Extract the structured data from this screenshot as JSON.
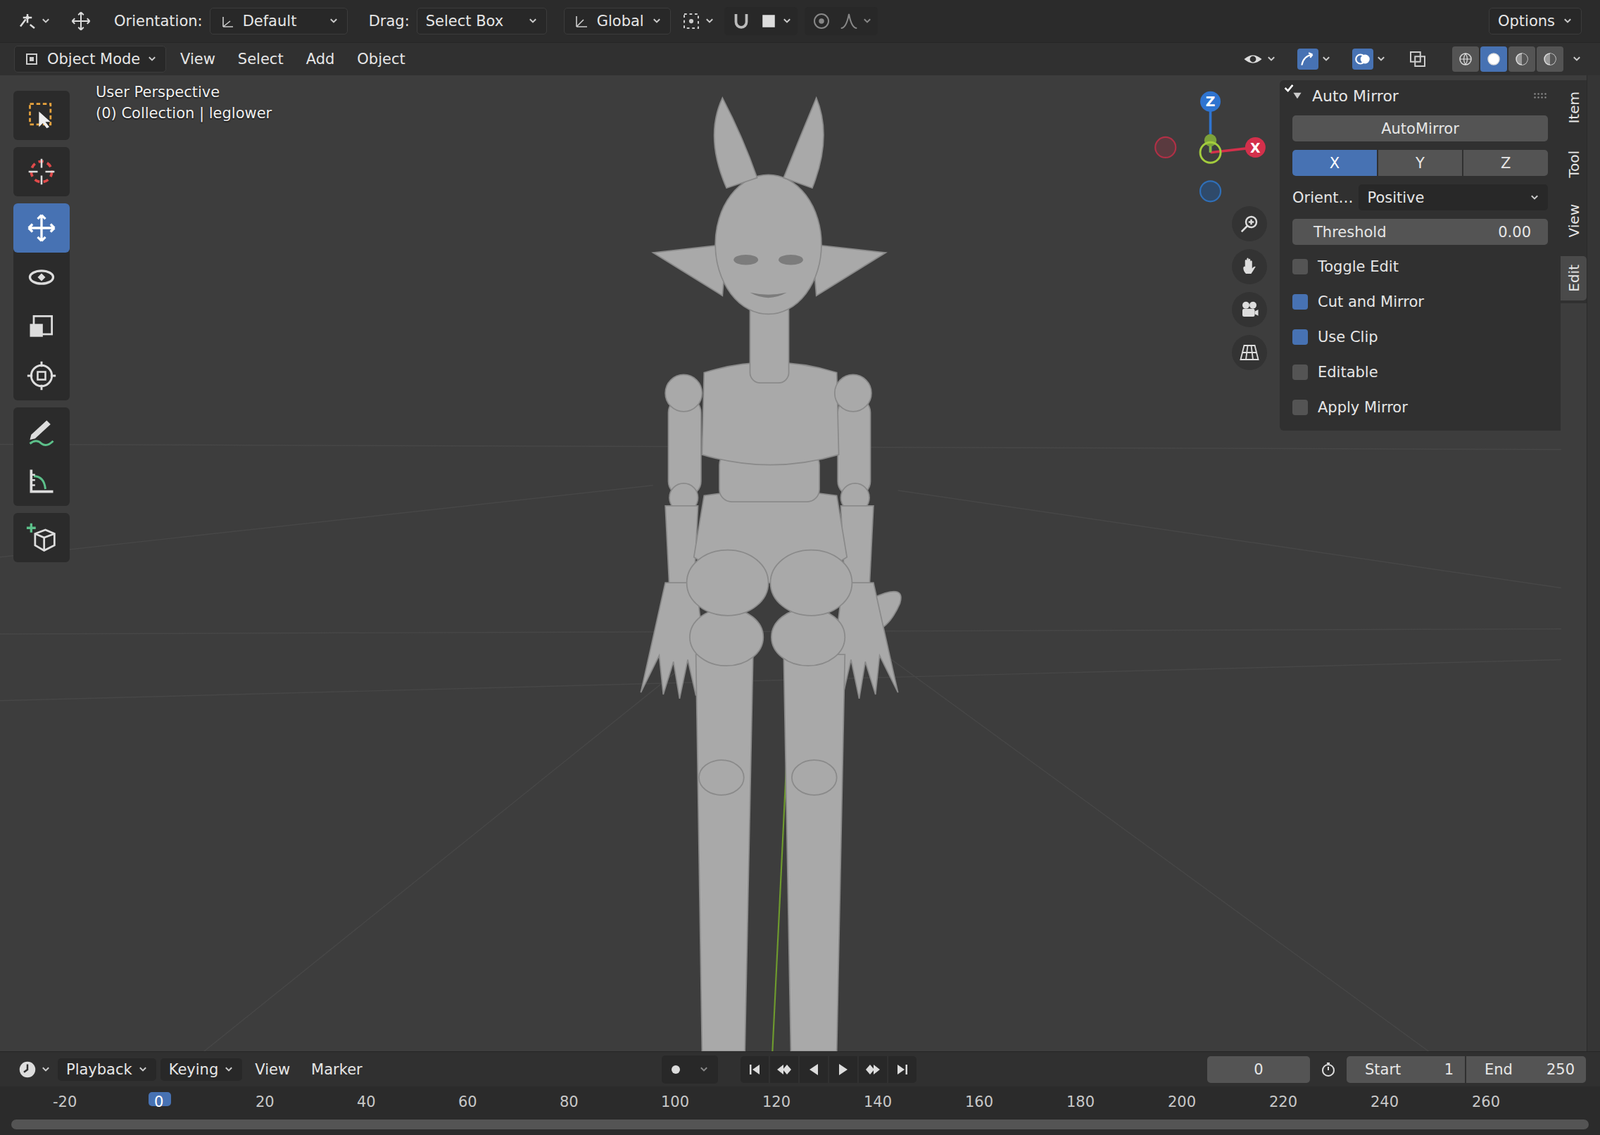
{
  "window": {
    "title": "Blender 3D Viewport"
  },
  "tool_settings": {
    "orientation_label": "Orientation:",
    "orientation": "Default",
    "drag_label": "Drag:",
    "drag": "Select Box",
    "transform_orientation": "Global",
    "options": "Options"
  },
  "header": {
    "mode": "Object Mode",
    "menus": [
      "View",
      "Select",
      "Add",
      "Object"
    ],
    "view_toggles": [
      {
        "kind": "visibility",
        "selected": false
      },
      {
        "kind": "gizmo",
        "selected": true
      },
      {
        "kind": "overlay",
        "selected": true
      },
      {
        "kind": "xray",
        "selected": false
      }
    ],
    "shading": [
      {
        "kind": "wireframe",
        "selected": false
      },
      {
        "kind": "solid",
        "selected": true
      },
      {
        "kind": "material",
        "selected": false
      },
      {
        "kind": "rendered",
        "selected": false
      }
    ]
  },
  "tool_groups": [
    [
      {
        "kind": "select-box",
        "selected": false
      }
    ],
    [
      {
        "kind": "cursor",
        "selected": false
      }
    ],
    [
      {
        "kind": "move",
        "selected": true
      },
      {
        "kind": "rotate",
        "selected": false
      },
      {
        "kind": "scale",
        "selected": false
      },
      {
        "kind": "transform",
        "selected": false
      }
    ],
    [
      {
        "kind": "annotate",
        "selected": false
      },
      {
        "kind": "measure",
        "selected": false
      }
    ],
    [
      {
        "kind": "add-cube",
        "selected": false
      }
    ]
  ],
  "viewport": {
    "view_name": "User Perspective",
    "collection": "(0) Collection | leglower"
  },
  "gizmo": {
    "axes": [
      {
        "label": "Z",
        "color": "#2f74d0"
      },
      {
        "label": "X",
        "color": "#d3304b"
      }
    ]
  },
  "sidebar": {
    "panel": "Auto Mirror",
    "expanded": true,
    "button": "AutoMirror",
    "axes": [
      {
        "label": "X",
        "selected": true
      },
      {
        "label": "Y",
        "selected": false
      },
      {
        "label": "Z",
        "selected": false
      }
    ],
    "orient_label": "Orient…",
    "orient": "Positive",
    "threshold_label": "Threshold",
    "threshold": "0.00",
    "options": [
      {
        "label": "Toggle Edit",
        "checked": false
      },
      {
        "label": "Cut and Mirror",
        "checked": true
      },
      {
        "label": "Use Clip",
        "checked": true
      },
      {
        "label": "Editable",
        "checked": false
      },
      {
        "label": "Apply Mirror",
        "checked": false
      }
    ],
    "tabs": [
      {
        "label": "Item",
        "selected": false
      },
      {
        "label": "Tool",
        "selected": false
      },
      {
        "label": "View",
        "selected": false
      },
      {
        "label": "Edit",
        "selected": true
      }
    ]
  },
  "timeline": {
    "menus": [
      {
        "label": "Playback",
        "dropdown": true
      },
      {
        "label": "Keying",
        "dropdown": true
      },
      {
        "label": "View",
        "dropdown": false
      },
      {
        "label": "Marker",
        "dropdown": false
      }
    ],
    "frame": "0",
    "start_label": "Start",
    "start": "1",
    "end_label": "End",
    "end": "250",
    "ticks": [
      {
        "label": "-20",
        "selected": false
      },
      {
        "label": "0",
        "selected": true
      },
      {
        "label": "20",
        "selected": false
      },
      {
        "label": "40",
        "selected": false
      },
      {
        "label": "60",
        "selected": false
      },
      {
        "label": "80",
        "selected": false
      },
      {
        "label": "100",
        "selected": false
      },
      {
        "label": "120",
        "selected": false
      },
      {
        "label": "140",
        "selected": false
      },
      {
        "label": "160",
        "selected": false
      },
      {
        "label": "180",
        "selected": false
      },
      {
        "label": "200",
        "selected": false
      },
      {
        "label": "220",
        "selected": false
      },
      {
        "label": "240",
        "selected": false
      },
      {
        "label": "260",
        "selected": false
      }
    ]
  }
}
